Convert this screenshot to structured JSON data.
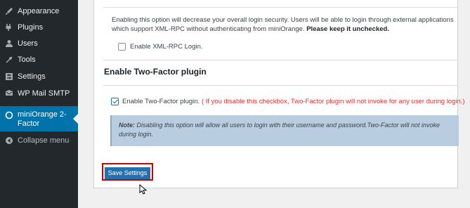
{
  "sidebar": {
    "items": [
      {
        "label": "Appearance",
        "icon": "paintbrush-icon"
      },
      {
        "label": "Plugins",
        "icon": "plugin-icon"
      },
      {
        "label": "Users",
        "icon": "users-icon"
      },
      {
        "label": "Tools",
        "icon": "wrench-icon"
      },
      {
        "label": "Settings",
        "icon": "settings-icon"
      },
      {
        "label": "WP Mail SMTP",
        "icon": "mail-icon"
      },
      {
        "label": "miniOrange 2-Factor",
        "icon": "miniorange-icon",
        "active": true
      }
    ],
    "collapse_label": "Collapse menu"
  },
  "xmlrpc": {
    "description": "Enabling this option will decrease your overall login security. Users will be able to login through external applications which support XML-RPC without authenticating from miniOrange.",
    "description_bold": "Please keep it unchecked.",
    "checkbox_label": "Enable XML-RPC Login.",
    "checked": false
  },
  "two_factor": {
    "heading": "Enable Two-Factor plugin",
    "checkbox_label": "Enable Two-Factor plugin.",
    "checkbox_warning": "( If you disable this checkbox, Two-Factor plugin will not invoke for any user during login.)",
    "checked": true,
    "note_prefix": "Note:",
    "note_text": "Disabling this option will allow all users to login with their username and password.Two-Factor will not invoke during login."
  },
  "save_label": "Save Settings",
  "colors": {
    "sidebar_bg": "#23282d",
    "active_bg": "#0073aa",
    "button_bg": "#2271b1",
    "highlight_border": "#d00000",
    "warning": "#dc3232",
    "note_bg": "#b8cde0"
  }
}
